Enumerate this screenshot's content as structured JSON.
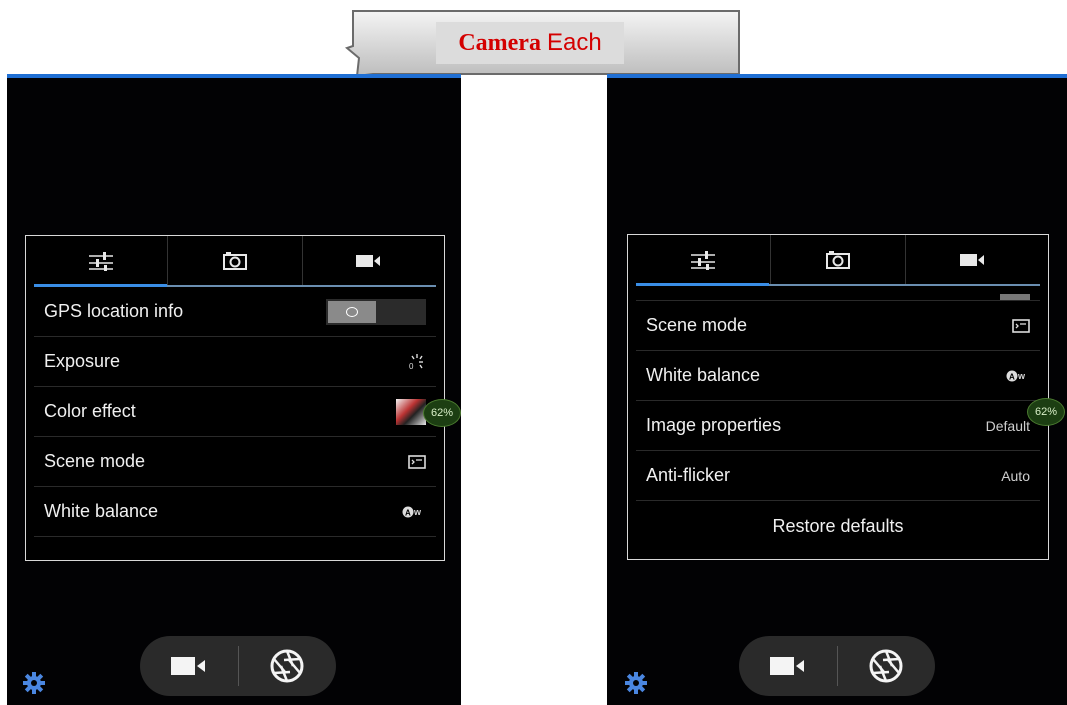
{
  "callout": {
    "word1": "Camera",
    "word2": "Each"
  },
  "left_screen": {
    "tabs": [
      {
        "icon": "sliders-icon"
      },
      {
        "icon": "camera-icon"
      },
      {
        "icon": "video-camera-icon"
      }
    ],
    "rows": [
      {
        "label": "GPS location info",
        "control": "toggle-off"
      },
      {
        "label": "Exposure",
        "icon": "exposure-icon"
      },
      {
        "label": "Color effect",
        "icon": "color-effect-thumbnail"
      },
      {
        "label": "Scene mode",
        "icon": "scene-icon"
      },
      {
        "label": "White balance",
        "icon": "auto-white-balance-icon"
      }
    ],
    "battery": "62%"
  },
  "right_screen": {
    "tabs": [
      {
        "icon": "sliders-icon"
      },
      {
        "icon": "camera-icon"
      },
      {
        "icon": "video-camera-icon"
      }
    ],
    "rows": [
      {
        "label": "Scene mode",
        "icon": "scene-icon"
      },
      {
        "label": "White balance",
        "icon": "auto-white-balance-icon"
      },
      {
        "label": "Image properties",
        "value": "Default"
      },
      {
        "label": "Anti-flicker",
        "value": "Auto"
      }
    ],
    "restore_label": "Restore defaults",
    "battery": "62%"
  },
  "colors": {
    "accent": "#3a8ee6",
    "background": "#020204",
    "panel_border": "#d8d8d8",
    "battery": "#1c3e12"
  }
}
